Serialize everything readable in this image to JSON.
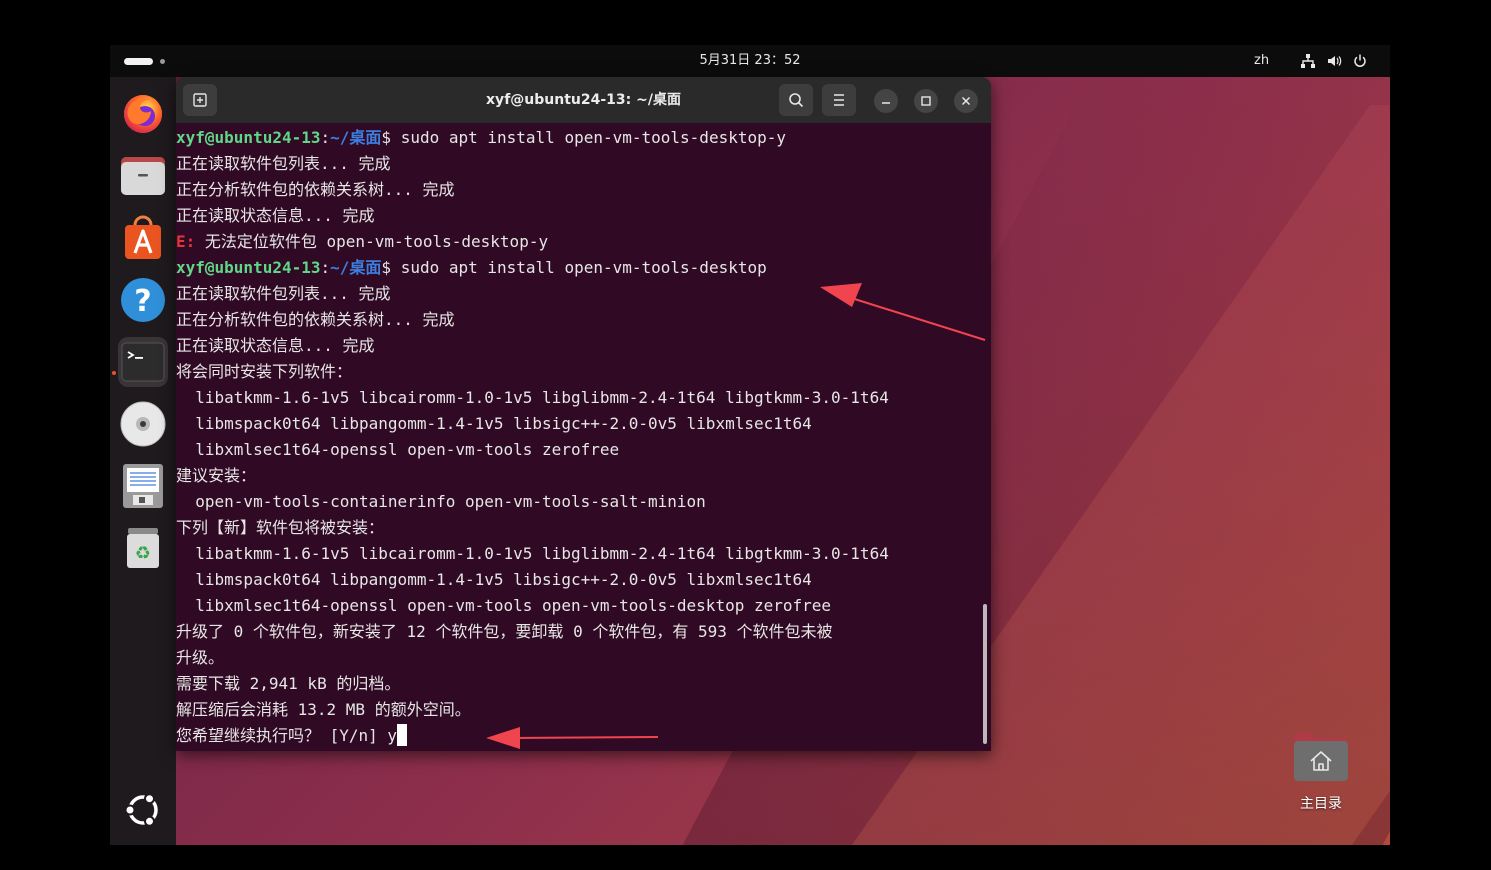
{
  "topbar": {
    "clock": "5月31日 23：52",
    "language": "zh"
  },
  "dock": {
    "items": [
      {
        "name": "firefox-icon"
      },
      {
        "name": "files-icon"
      },
      {
        "name": "app-center-icon"
      },
      {
        "name": "help-icon"
      },
      {
        "name": "terminal-icon",
        "active": true
      },
      {
        "name": "dvd-icon"
      },
      {
        "name": "text-editor-icon"
      },
      {
        "name": "trash-icon"
      }
    ],
    "show_apps_icon": "ubuntu-logo-icon"
  },
  "terminal": {
    "title": "xyf@ubuntu24-13: ~/桌面",
    "lines": [
      {
        "type": "prompt",
        "user": "xyf@ubuntu24-13",
        "sep": ":",
        "path": "~/桌面",
        "cmd": "$ sudo apt install open-vm-tools-desktop-y"
      },
      {
        "type": "text",
        "text": "正在读取软件包列表... 完成"
      },
      {
        "type": "text",
        "text": "正在分析软件包的依赖关系树... 完成"
      },
      {
        "type": "text",
        "text": "正在读取状态信息... 完成"
      },
      {
        "type": "error",
        "label": "E:",
        "text": " 无法定位软件包 open-vm-tools-desktop-y"
      },
      {
        "type": "prompt",
        "user": "xyf@ubuntu24-13",
        "sep": ":",
        "path": "~/桌面",
        "cmd": "$ sudo apt install open-vm-tools-desktop"
      },
      {
        "type": "text",
        "text": "正在读取软件包列表... 完成"
      },
      {
        "type": "text",
        "text": "正在分析软件包的依赖关系树... 完成"
      },
      {
        "type": "text",
        "text": "正在读取状态信息... 完成"
      },
      {
        "type": "text",
        "text": "将会同时安装下列软件："
      },
      {
        "type": "text",
        "text": "  libatkmm-1.6-1v5 libcairomm-1.0-1v5 libglibmm-2.4-1t64 libgtkmm-3.0-1t64"
      },
      {
        "type": "text",
        "text": "  libmspack0t64 libpangomm-1.4-1v5 libsigc++-2.0-0v5 libxmlsec1t64"
      },
      {
        "type": "text",
        "text": "  libxmlsec1t64-openssl open-vm-tools zerofree"
      },
      {
        "type": "text",
        "text": "建议安装："
      },
      {
        "type": "text",
        "text": "  open-vm-tools-containerinfo open-vm-tools-salt-minion"
      },
      {
        "type": "text",
        "text": "下列【新】软件包将被安装："
      },
      {
        "type": "text",
        "text": "  libatkmm-1.6-1v5 libcairomm-1.0-1v5 libglibmm-2.4-1t64 libgtkmm-3.0-1t64"
      },
      {
        "type": "text",
        "text": "  libmspack0t64 libpangomm-1.4-1v5 libsigc++-2.0-0v5 libxmlsec1t64"
      },
      {
        "type": "text",
        "text": "  libxmlsec1t64-openssl open-vm-tools open-vm-tools-desktop zerofree"
      },
      {
        "type": "text",
        "text": "升级了 0 个软件包，新安装了 12 个软件包，要卸载 0 个软件包，有 593 个软件包未被"
      },
      {
        "type": "text",
        "text": "升级。"
      },
      {
        "type": "text",
        "text": "需要下载 2,941 kB 的归档。"
      },
      {
        "type": "text",
        "text": "解压缩后会消耗 13.2 MB 的额外空间。"
      },
      {
        "type": "input",
        "text": "您希望继续执行吗？ [Y/n] y"
      }
    ]
  },
  "desktop": {
    "home_folder_label": "主目录"
  },
  "colors": {
    "terminal_bg": "#300a24",
    "prompt_user": "#5fd787",
    "prompt_path": "#3d7fe0",
    "error": "#e0353d",
    "annotation_arrow": "#f0454f",
    "accent": "#e95420"
  }
}
